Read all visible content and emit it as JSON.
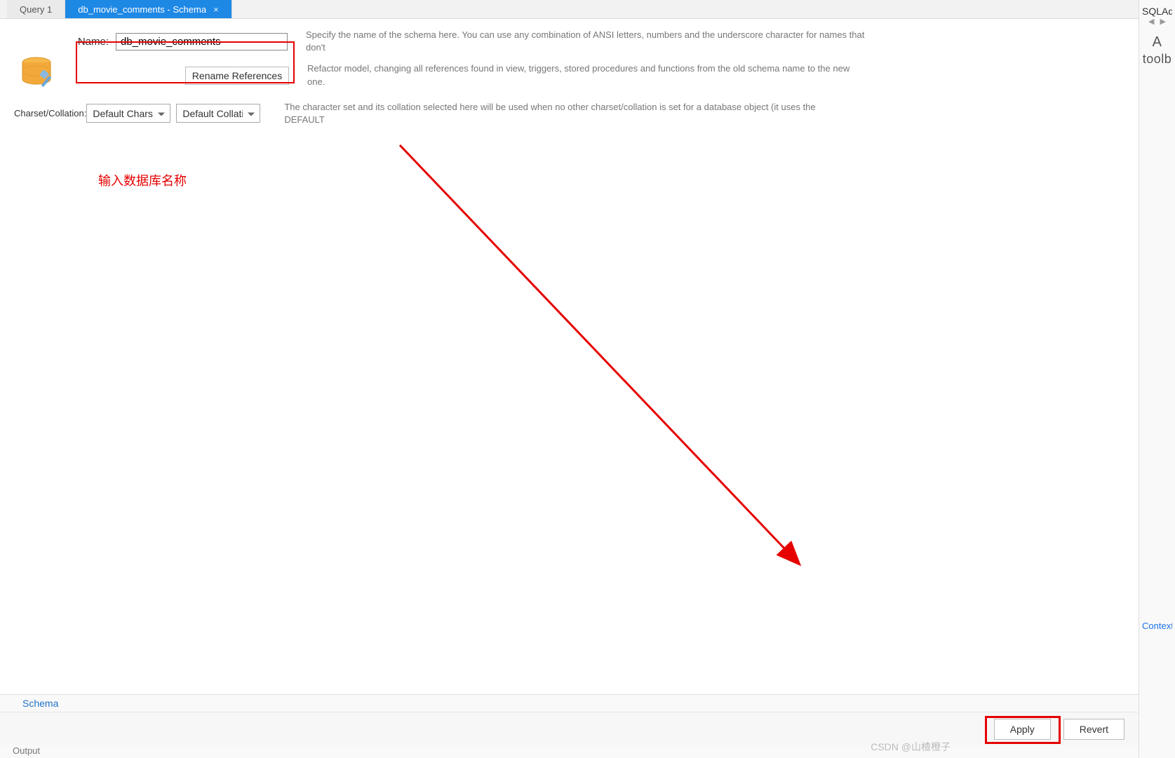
{
  "tabs": {
    "items": [
      {
        "label": "Query 1",
        "active": false,
        "closable": false
      },
      {
        "label": "db_movie_comments - Schema",
        "active": true,
        "closable": true
      }
    ]
  },
  "sidePanel": {
    "title": "SQLAdd",
    "big1": "A",
    "big2": "toolb",
    "context": "Context"
  },
  "form": {
    "name_label": "Name:",
    "name_value": "db_movie_comments",
    "name_desc": "Specify the name of the schema here. You can use any combination of ANSI letters, numbers and the underscore character for names that don't",
    "rename_label": "Rename References",
    "rename_desc": "Refactor model, changing all references found in view, triggers, stored procedures and functions from the old schema name to the new one.",
    "charset_label": "Charset/Collation:",
    "charset_value": "Default Charset",
    "collation_value": "Default Collation",
    "charset_desc": "The character set and its collation selected here will be used when no other charset/collation is set for a database object (it uses the DEFAULT"
  },
  "annotation": "输入数据库名称",
  "bottomTabs": {
    "schema": "Schema"
  },
  "actions": {
    "apply": "Apply",
    "revert": "Revert"
  },
  "output_label": "Output",
  "watermark": "CSDN @山楂橙子"
}
